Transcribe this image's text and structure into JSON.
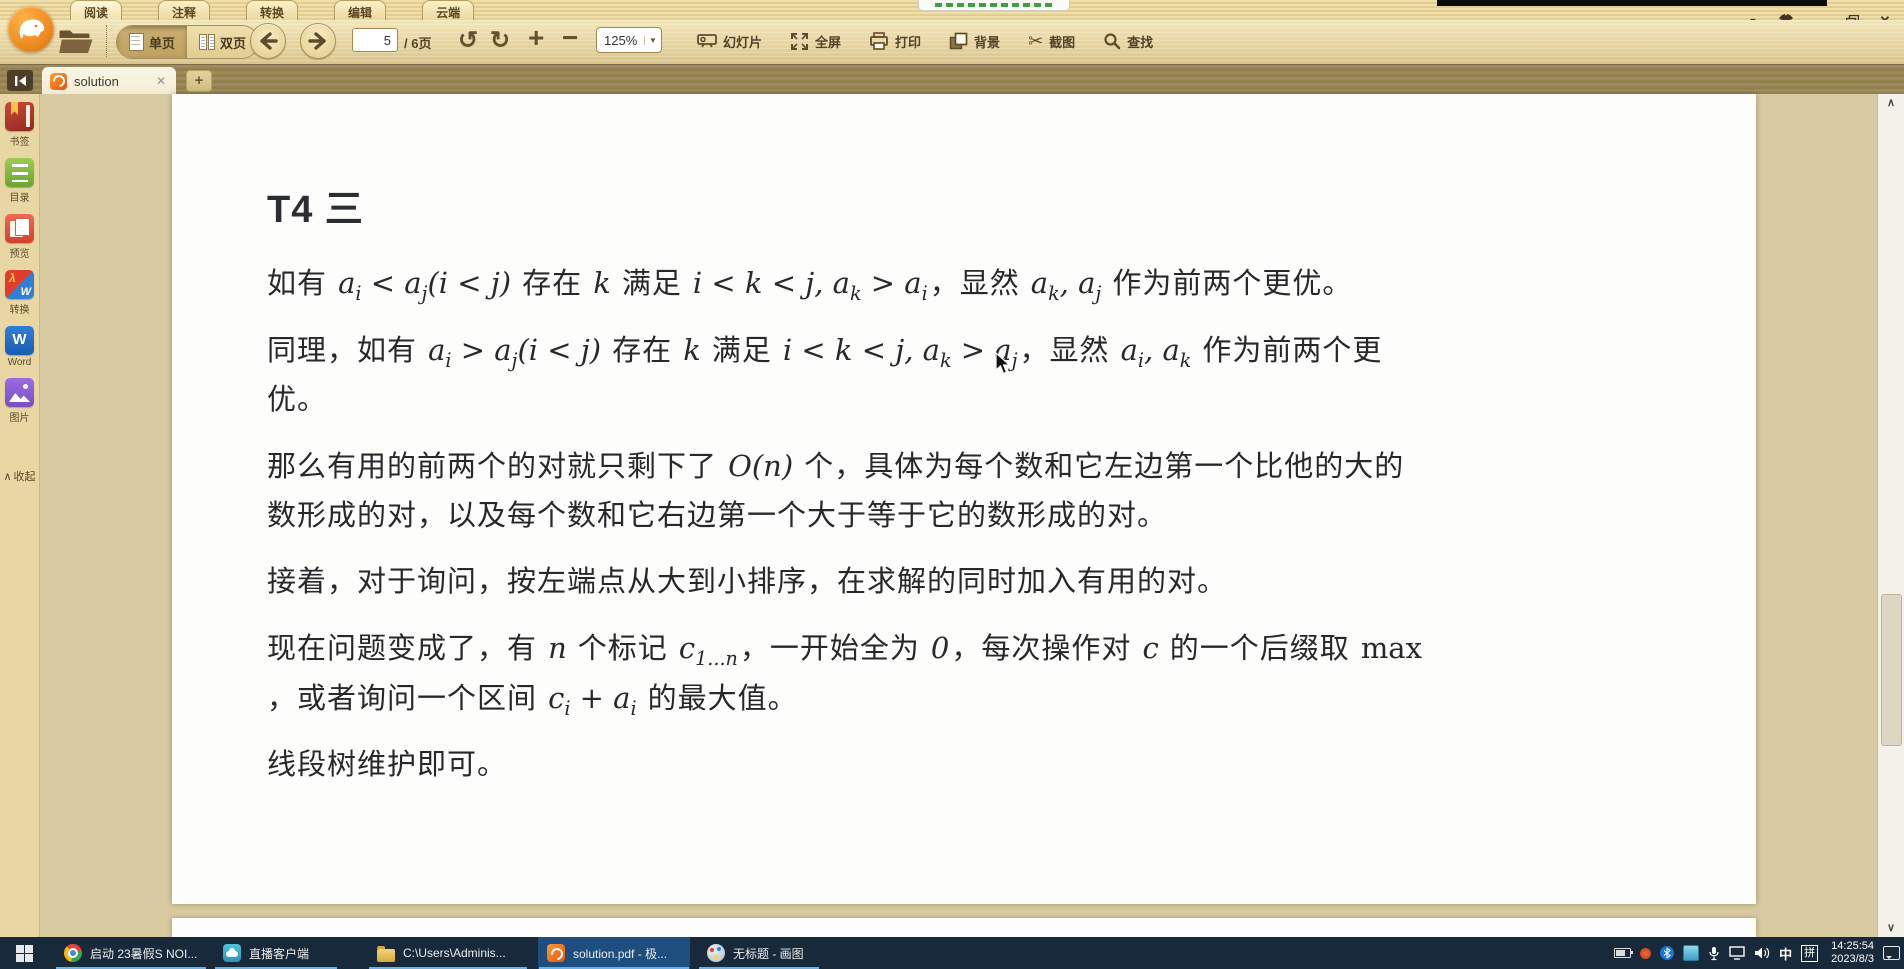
{
  "app": {
    "menu_tabs": [
      {
        "label": "阅读"
      },
      {
        "label": "注释"
      },
      {
        "label": "转换"
      },
      {
        "label": "编辑"
      },
      {
        "label": "云端"
      }
    ]
  },
  "toolbar": {
    "single_page": "单页",
    "double_page": "双页",
    "page_current": "5",
    "page_total_suffix": "/ 6页",
    "undo_glyph": "↺",
    "redo_glyph": "↻",
    "plus_glyph": "+",
    "minus_glyph": "−",
    "zoom_value": "125%",
    "caret_glyph": "▼",
    "scissors_glyph": "✂",
    "actions": [
      {
        "label": "幻灯片"
      },
      {
        "label": "全屏"
      },
      {
        "label": "打印"
      },
      {
        "label": "背景"
      },
      {
        "label": "截图"
      },
      {
        "label": "查找"
      }
    ]
  },
  "tab_bar": {
    "active_tab_title": "solution",
    "close_glyph": "✕",
    "new_tab_glyph": "+"
  },
  "sidebar": {
    "items": [
      {
        "label": "书签"
      },
      {
        "label": "目录"
      },
      {
        "label": "预览"
      },
      {
        "label": "转换"
      },
      {
        "label": "Word"
      },
      {
        "label": "图片"
      }
    ],
    "collapse_glyph": "∧",
    "collapse_label": "收起"
  },
  "document": {
    "title": "T4 三",
    "paragraphs": [
      [
        {
          "t": "如有 "
        },
        {
          "m": "a_i < a_j(i < j)"
        },
        {
          "t": " 存在 "
        },
        {
          "m": "k"
        },
        {
          "t": " 满足 "
        },
        {
          "m": "i < k < j, a_k > a_i"
        },
        {
          "t": "，显然 "
        },
        {
          "m": "a_k, a_j"
        },
        {
          "t": " 作为前两个更优。"
        }
      ],
      [
        {
          "t": "同理，如有 "
        },
        {
          "m": "a_i > a_j(i < j)"
        },
        {
          "t": " 存在 "
        },
        {
          "m": "k"
        },
        {
          "t": " 满足 "
        },
        {
          "m": "i < k < j, a_k > a_j"
        },
        {
          "t": "，显然 "
        },
        {
          "m": "a_i, a_k"
        },
        {
          "t": " 作为前两个更"
        },
        {
          "br": true
        },
        {
          "t": "优。"
        }
      ],
      [
        {
          "t": "那么有用的前两个的对就只剩下了 "
        },
        {
          "m": "O(n)"
        },
        {
          "t": " 个，具体为每个数和它左边第一个比他的大的"
        },
        {
          "br": true
        },
        {
          "t": "数形成的对，以及每个数和它右边第一个大于等于它的数形成的对。"
        }
      ],
      [
        {
          "t": "接着，对于询问，按左端点从大到小排序，在求解的同时加入有用的对。"
        }
      ],
      [
        {
          "t": "现在问题变成了，有 "
        },
        {
          "m": "n"
        },
        {
          "t": " 个标记 "
        },
        {
          "m": "c_{1...n}"
        },
        {
          "t": "，一开始全为 "
        },
        {
          "m": "0"
        },
        {
          "t": "，每次操作对 "
        },
        {
          "m": "c"
        },
        {
          "t": " 的一个后缀取 "
        },
        {
          "rm": "max"
        },
        {
          "br": true
        },
        {
          "t": "，或者询问一个区间 "
        },
        {
          "m": "c_i + a_i"
        },
        {
          "t": " 的最大值。"
        }
      ],
      [
        {
          "t": "线段树维护即可。"
        }
      ]
    ]
  },
  "scrollbar": {
    "up_glyph": "∧",
    "down_glyph": "∨"
  },
  "taskbar": {
    "items": [
      {
        "label": "启动 23暑假S NOI..."
      },
      {
        "label": "直播客户端"
      },
      {
        "label": "C:\\Users\\Adminis..."
      },
      {
        "label": "solution.pdf - 极..."
      },
      {
        "label": "无标题 - 画图"
      }
    ],
    "tray": {
      "ime_primary": "中",
      "ime_secondary": "拼",
      "time": "14:25:54",
      "date": "2023/8/3"
    }
  }
}
